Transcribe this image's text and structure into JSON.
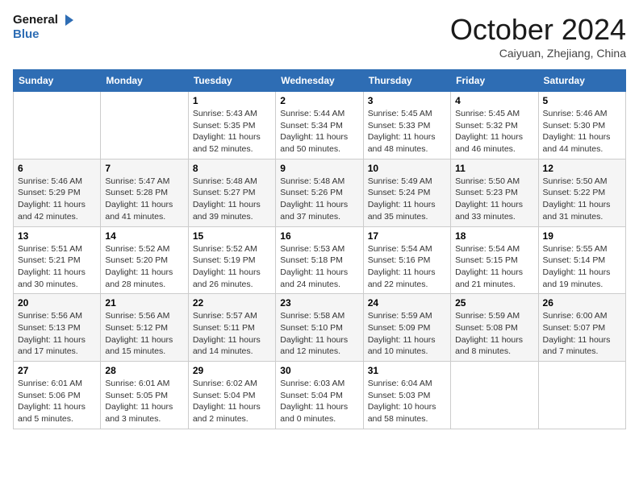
{
  "header": {
    "logo_line1": "General",
    "logo_line2": "Blue",
    "month_title": "October 2024",
    "location": "Caiyuan, Zhejiang, China"
  },
  "weekdays": [
    "Sunday",
    "Monday",
    "Tuesday",
    "Wednesday",
    "Thursday",
    "Friday",
    "Saturday"
  ],
  "weeks": [
    [
      {
        "day": "",
        "sunrise": "",
        "sunset": "",
        "daylight": ""
      },
      {
        "day": "",
        "sunrise": "",
        "sunset": "",
        "daylight": ""
      },
      {
        "day": "1",
        "sunrise": "Sunrise: 5:43 AM",
        "sunset": "Sunset: 5:35 PM",
        "daylight": "Daylight: 11 hours and 52 minutes."
      },
      {
        "day": "2",
        "sunrise": "Sunrise: 5:44 AM",
        "sunset": "Sunset: 5:34 PM",
        "daylight": "Daylight: 11 hours and 50 minutes."
      },
      {
        "day": "3",
        "sunrise": "Sunrise: 5:45 AM",
        "sunset": "Sunset: 5:33 PM",
        "daylight": "Daylight: 11 hours and 48 minutes."
      },
      {
        "day": "4",
        "sunrise": "Sunrise: 5:45 AM",
        "sunset": "Sunset: 5:32 PM",
        "daylight": "Daylight: 11 hours and 46 minutes."
      },
      {
        "day": "5",
        "sunrise": "Sunrise: 5:46 AM",
        "sunset": "Sunset: 5:30 PM",
        "daylight": "Daylight: 11 hours and 44 minutes."
      }
    ],
    [
      {
        "day": "6",
        "sunrise": "Sunrise: 5:46 AM",
        "sunset": "Sunset: 5:29 PM",
        "daylight": "Daylight: 11 hours and 42 minutes."
      },
      {
        "day": "7",
        "sunrise": "Sunrise: 5:47 AM",
        "sunset": "Sunset: 5:28 PM",
        "daylight": "Daylight: 11 hours and 41 minutes."
      },
      {
        "day": "8",
        "sunrise": "Sunrise: 5:48 AM",
        "sunset": "Sunset: 5:27 PM",
        "daylight": "Daylight: 11 hours and 39 minutes."
      },
      {
        "day": "9",
        "sunrise": "Sunrise: 5:48 AM",
        "sunset": "Sunset: 5:26 PM",
        "daylight": "Daylight: 11 hours and 37 minutes."
      },
      {
        "day": "10",
        "sunrise": "Sunrise: 5:49 AM",
        "sunset": "Sunset: 5:24 PM",
        "daylight": "Daylight: 11 hours and 35 minutes."
      },
      {
        "day": "11",
        "sunrise": "Sunrise: 5:50 AM",
        "sunset": "Sunset: 5:23 PM",
        "daylight": "Daylight: 11 hours and 33 minutes."
      },
      {
        "day": "12",
        "sunrise": "Sunrise: 5:50 AM",
        "sunset": "Sunset: 5:22 PM",
        "daylight": "Daylight: 11 hours and 31 minutes."
      }
    ],
    [
      {
        "day": "13",
        "sunrise": "Sunrise: 5:51 AM",
        "sunset": "Sunset: 5:21 PM",
        "daylight": "Daylight: 11 hours and 30 minutes."
      },
      {
        "day": "14",
        "sunrise": "Sunrise: 5:52 AM",
        "sunset": "Sunset: 5:20 PM",
        "daylight": "Daylight: 11 hours and 28 minutes."
      },
      {
        "day": "15",
        "sunrise": "Sunrise: 5:52 AM",
        "sunset": "Sunset: 5:19 PM",
        "daylight": "Daylight: 11 hours and 26 minutes."
      },
      {
        "day": "16",
        "sunrise": "Sunrise: 5:53 AM",
        "sunset": "Sunset: 5:18 PM",
        "daylight": "Daylight: 11 hours and 24 minutes."
      },
      {
        "day": "17",
        "sunrise": "Sunrise: 5:54 AM",
        "sunset": "Sunset: 5:16 PM",
        "daylight": "Daylight: 11 hours and 22 minutes."
      },
      {
        "day": "18",
        "sunrise": "Sunrise: 5:54 AM",
        "sunset": "Sunset: 5:15 PM",
        "daylight": "Daylight: 11 hours and 21 minutes."
      },
      {
        "day": "19",
        "sunrise": "Sunrise: 5:55 AM",
        "sunset": "Sunset: 5:14 PM",
        "daylight": "Daylight: 11 hours and 19 minutes."
      }
    ],
    [
      {
        "day": "20",
        "sunrise": "Sunrise: 5:56 AM",
        "sunset": "Sunset: 5:13 PM",
        "daylight": "Daylight: 11 hours and 17 minutes."
      },
      {
        "day": "21",
        "sunrise": "Sunrise: 5:56 AM",
        "sunset": "Sunset: 5:12 PM",
        "daylight": "Daylight: 11 hours and 15 minutes."
      },
      {
        "day": "22",
        "sunrise": "Sunrise: 5:57 AM",
        "sunset": "Sunset: 5:11 PM",
        "daylight": "Daylight: 11 hours and 14 minutes."
      },
      {
        "day": "23",
        "sunrise": "Sunrise: 5:58 AM",
        "sunset": "Sunset: 5:10 PM",
        "daylight": "Daylight: 11 hours and 12 minutes."
      },
      {
        "day": "24",
        "sunrise": "Sunrise: 5:59 AM",
        "sunset": "Sunset: 5:09 PM",
        "daylight": "Daylight: 11 hours and 10 minutes."
      },
      {
        "day": "25",
        "sunrise": "Sunrise: 5:59 AM",
        "sunset": "Sunset: 5:08 PM",
        "daylight": "Daylight: 11 hours and 8 minutes."
      },
      {
        "day": "26",
        "sunrise": "Sunrise: 6:00 AM",
        "sunset": "Sunset: 5:07 PM",
        "daylight": "Daylight: 11 hours and 7 minutes."
      }
    ],
    [
      {
        "day": "27",
        "sunrise": "Sunrise: 6:01 AM",
        "sunset": "Sunset: 5:06 PM",
        "daylight": "Daylight: 11 hours and 5 minutes."
      },
      {
        "day": "28",
        "sunrise": "Sunrise: 6:01 AM",
        "sunset": "Sunset: 5:05 PM",
        "daylight": "Daylight: 11 hours and 3 minutes."
      },
      {
        "day": "29",
        "sunrise": "Sunrise: 6:02 AM",
        "sunset": "Sunset: 5:04 PM",
        "daylight": "Daylight: 11 hours and 2 minutes."
      },
      {
        "day": "30",
        "sunrise": "Sunrise: 6:03 AM",
        "sunset": "Sunset: 5:04 PM",
        "daylight": "Daylight: 11 hours and 0 minutes."
      },
      {
        "day": "31",
        "sunrise": "Sunrise: 6:04 AM",
        "sunset": "Sunset: 5:03 PM",
        "daylight": "Daylight: 10 hours and 58 minutes."
      },
      {
        "day": "",
        "sunrise": "",
        "sunset": "",
        "daylight": ""
      },
      {
        "day": "",
        "sunrise": "",
        "sunset": "",
        "daylight": ""
      }
    ]
  ]
}
